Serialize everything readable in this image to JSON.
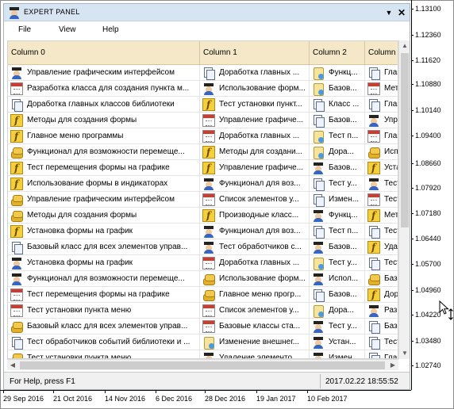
{
  "chart": {
    "prices": [
      "1.13100",
      "1.12360",
      "1.11620",
      "1.10880",
      "1.10140",
      "1.09400",
      "1.08660",
      "1.07920",
      "1.07180",
      "1.06440",
      "1.05700",
      "1.04960",
      "1.04220",
      "1.03480",
      "1.02740"
    ],
    "dates": [
      "29 Sep 2016",
      "21 Oct 2016",
      "14 Nov 2016",
      "6 Dec 2016",
      "28 Dec 2016",
      "19 Jan 2017",
      "10 Feb 2017"
    ]
  },
  "panel": {
    "title": "EXPERT PANEL",
    "minimize_glyph": "▼",
    "close_glyph": "✕",
    "menu": [
      "File",
      "View",
      "Help"
    ],
    "columns": [
      "Column 0",
      "Column 1",
      "Column 2",
      "Column 3"
    ],
    "rows": [
      [
        {
          "icon": "user-icon",
          "text": "Управление графическим интерфейсом"
        },
        {
          "icon": "docs-icon",
          "text": "Доработка главных ..."
        },
        {
          "icon": "scroll-icon",
          "text": "Функц..."
        },
        {
          "icon": "docs-icon",
          "text": "Глав..."
        }
      ],
      [
        {
          "icon": "calendar-icon",
          "text": "Разработка класса для создания пункта м..."
        },
        {
          "icon": "user-icon",
          "text": "Использование форм..."
        },
        {
          "icon": "scroll-icon",
          "text": "Базов..."
        },
        {
          "icon": "calendar-icon",
          "text": "Мето..."
        }
      ],
      [
        {
          "icon": "docs-icon",
          "text": "Доработка главных классов библиотеки"
        },
        {
          "icon": "function-icon",
          "text": "Тест установки пункт..."
        },
        {
          "icon": "docs-icon",
          "text": "Класс ..."
        },
        {
          "icon": "docs-icon",
          "text": "Глав..."
        }
      ],
      [
        {
          "icon": "function-icon",
          "text": "Методы для создания формы"
        },
        {
          "icon": "calendar-icon",
          "text": "Управление графиче..."
        },
        {
          "icon": "docs-icon",
          "text": "Базов..."
        },
        {
          "icon": "user-icon",
          "text": "Упра..."
        }
      ],
      [
        {
          "icon": "function-icon",
          "text": "Главное меню программы"
        },
        {
          "icon": "calendar-icon",
          "text": "Доработка главных ..."
        },
        {
          "icon": "scroll-icon",
          "text": "Тест п..."
        },
        {
          "icon": "calendar-icon",
          "text": "Глав..."
        }
      ],
      [
        {
          "icon": "coins-icon",
          "text": "Функционал для возможности перемеще..."
        },
        {
          "icon": "function-icon",
          "text": "Методы для создани..."
        },
        {
          "icon": "scroll-icon",
          "text": "Дора..."
        },
        {
          "icon": "coins-icon",
          "text": "Испо..."
        }
      ],
      [
        {
          "icon": "function-icon",
          "text": "Тест перемещения формы на графике"
        },
        {
          "icon": "function-icon",
          "text": "Управление графиче..."
        },
        {
          "icon": "user-icon",
          "text": "Базов..."
        },
        {
          "icon": "function-icon",
          "text": "Уста..."
        }
      ],
      [
        {
          "icon": "function-icon",
          "text": "Использование формы в индикаторах"
        },
        {
          "icon": "user-icon",
          "text": "Функционал для воз..."
        },
        {
          "icon": "docs-icon",
          "text": "Тест у..."
        },
        {
          "icon": "user-icon",
          "text": "Тест..."
        }
      ],
      [
        {
          "icon": "coins-icon",
          "text": "Управление графическим интерфейсом"
        },
        {
          "icon": "calendar-icon",
          "text": "Список элементов у..."
        },
        {
          "icon": "docs-icon",
          "text": "Измен..."
        },
        {
          "icon": "calendar-icon",
          "text": "Тест..."
        }
      ],
      [
        {
          "icon": "coins-icon",
          "text": "Методы для создания формы"
        },
        {
          "icon": "function-icon",
          "text": "Производные класс..."
        },
        {
          "icon": "user-icon",
          "text": "Функц..."
        },
        {
          "icon": "function-icon",
          "text": "Мето..."
        }
      ],
      [
        {
          "icon": "function-icon",
          "text": "Установка формы на график"
        },
        {
          "icon": "user-icon",
          "text": "Функционал для воз..."
        },
        {
          "icon": "docs-icon",
          "text": "Тест п..."
        },
        {
          "icon": "docs-icon",
          "text": "Тест..."
        }
      ],
      [
        {
          "icon": "docs-icon",
          "text": "Базовый класс для всех элементов управ..."
        },
        {
          "icon": "user-icon",
          "text": "Тест обработчиков с..."
        },
        {
          "icon": "user-icon",
          "text": "Базов..."
        },
        {
          "icon": "function-icon",
          "text": "Удал..."
        }
      ],
      [
        {
          "icon": "user-icon",
          "text": "Установка формы на график"
        },
        {
          "icon": "calendar-icon",
          "text": "Доработка главных ..."
        },
        {
          "icon": "scroll-icon",
          "text": "Тест у..."
        },
        {
          "icon": "docs-icon",
          "text": "Тест..."
        }
      ],
      [
        {
          "icon": "user-icon",
          "text": "Функционал для возможности перемеще..."
        },
        {
          "icon": "coins-icon",
          "text": "Использование форм..."
        },
        {
          "icon": "user-icon",
          "text": "Испол..."
        },
        {
          "icon": "coins-icon",
          "text": "Базо..."
        }
      ],
      [
        {
          "icon": "calendar-icon",
          "text": "Тест перемещения формы на графике"
        },
        {
          "icon": "coins-icon",
          "text": "Главное меню прогр..."
        },
        {
          "icon": "docs-icon",
          "text": "Базов..."
        },
        {
          "icon": "function-icon",
          "text": "Дора..."
        }
      ],
      [
        {
          "icon": "calendar-icon",
          "text": "Тест установки пункта меню"
        },
        {
          "icon": "calendar-icon",
          "text": "Список элементов у..."
        },
        {
          "icon": "scroll-icon",
          "text": "Дора..."
        },
        {
          "icon": "user-icon",
          "text": "Разр..."
        }
      ],
      [
        {
          "icon": "coins-icon",
          "text": "Базовый класс для всех элементов управ..."
        },
        {
          "icon": "calendar-icon",
          "text": "Базовые классы ста..."
        },
        {
          "icon": "user-icon",
          "text": "Тест у..."
        },
        {
          "icon": "docs-icon",
          "text": "Базо..."
        }
      ],
      [
        {
          "icon": "docs-icon",
          "text": "Тест обработчиков событий библиотеки и ..."
        },
        {
          "icon": "scroll-icon",
          "text": "Изменение внешнег..."
        },
        {
          "icon": "user-icon",
          "text": "Устан..."
        },
        {
          "icon": "docs-icon",
          "text": "Тест..."
        }
      ],
      [
        {
          "icon": "coins-icon",
          "text": "Тест установки пункта меню"
        },
        {
          "icon": "user-icon",
          "text": "Удаление элементо..."
        },
        {
          "icon": "user-icon",
          "text": "Измен..."
        },
        {
          "icon": "docs-icon",
          "text": "Глав..."
        }
      ]
    ],
    "status": {
      "help": "For Help, press F1",
      "time": "2017.02.22 18:55:52"
    }
  }
}
